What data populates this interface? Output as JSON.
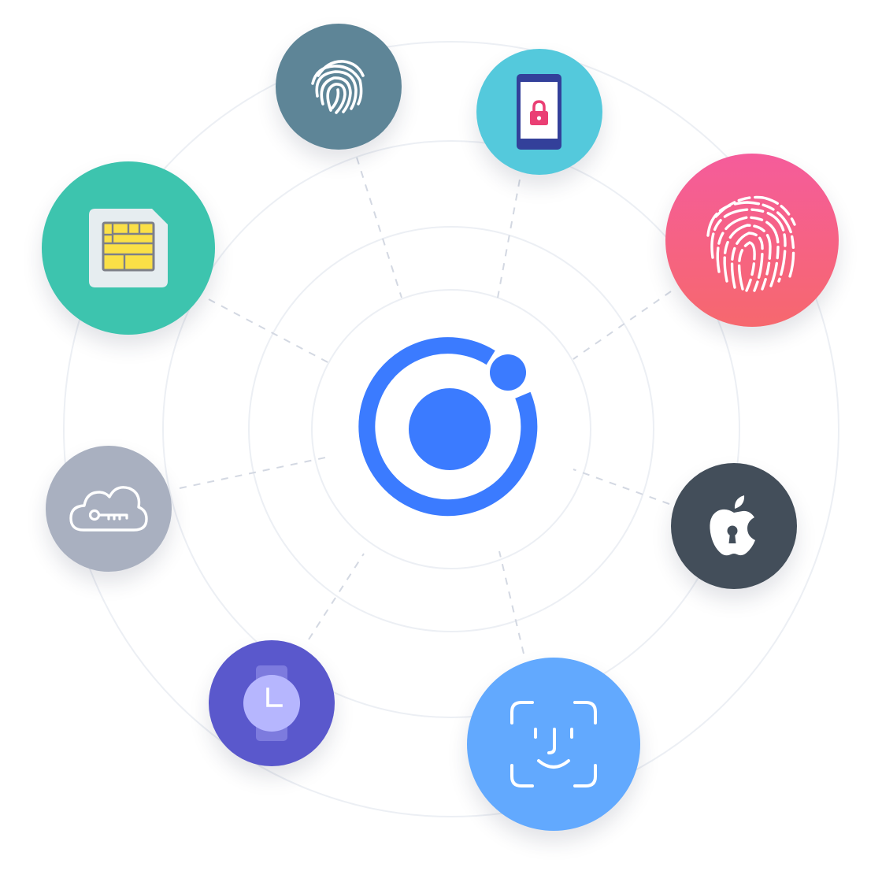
{
  "colors": {
    "background": "#ffffff",
    "rings": "#eceff4",
    "dashes": "#d3d8e2",
    "hub_blue": "#3b7bff"
  },
  "hub": {
    "icon": "ionic-logo-icon",
    "color": "#3b7bff"
  },
  "nodes": [
    {
      "id": "fingerprint-top",
      "icon": "fingerprint-icon",
      "color": "#5e8597"
    },
    {
      "id": "phone-lock",
      "icon": "phone-lock-icon",
      "color": "#54c9dc"
    },
    {
      "id": "fingerprint-pink",
      "icon": "fingerprint-icon",
      "color": "#f55c97"
    },
    {
      "id": "sim-card",
      "icon": "sim-card-icon",
      "color": "#3dc4ae"
    },
    {
      "id": "cloud-key",
      "icon": "cloud-key-icon",
      "color": "#a9b0c0"
    },
    {
      "id": "apple-keychain",
      "icon": "apple-lock-icon",
      "color": "#434e5a"
    },
    {
      "id": "watch",
      "icon": "watch-icon",
      "color": "#5a58cc"
    },
    {
      "id": "face-id",
      "icon": "face-id-icon",
      "color": "#62a9fe"
    }
  ]
}
